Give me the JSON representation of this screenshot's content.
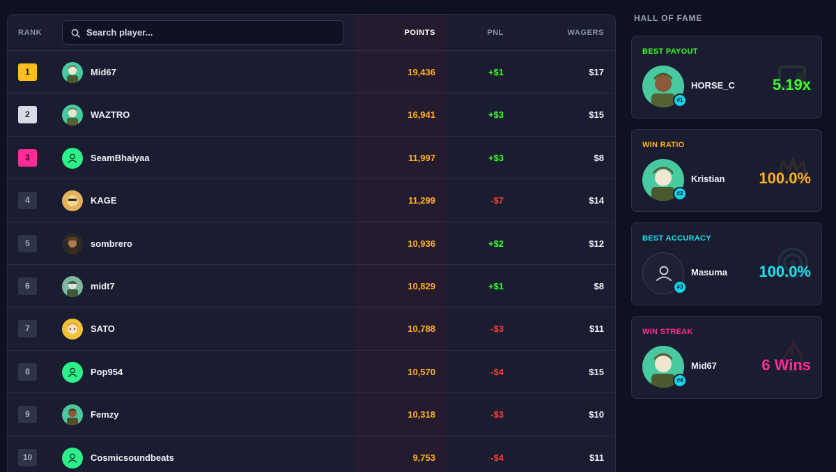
{
  "table": {
    "headers": {
      "rank": "RANK",
      "points": "POINTS",
      "pnl": "PNL",
      "wagers": "WAGERS"
    },
    "search": {
      "placeholder": "Search player..."
    },
    "rows": [
      {
        "rank": "1",
        "name": "Mid67",
        "points": "19,436",
        "pnl": "+$1",
        "wagers": "$17"
      },
      {
        "rank": "2",
        "name": "WAZTRO",
        "points": "16,941",
        "pnl": "+$3",
        "wagers": "$15"
      },
      {
        "rank": "3",
        "name": "SeamBhaiyaa",
        "points": "11,997",
        "pnl": "+$3",
        "wagers": "$8"
      },
      {
        "rank": "4",
        "name": "KAGE",
        "points": "11,299",
        "pnl": "-$7",
        "wagers": "$14"
      },
      {
        "rank": "5",
        "name": "sombrero",
        "points": "10,936",
        "pnl": "+$2",
        "wagers": "$12"
      },
      {
        "rank": "6",
        "name": "midt7",
        "points": "10,829",
        "pnl": "+$1",
        "wagers": "$8"
      },
      {
        "rank": "7",
        "name": "SATO",
        "points": "10,788",
        "pnl": "-$3",
        "wagers": "$11"
      },
      {
        "rank": "8",
        "name": "Pop954",
        "points": "10,570",
        "pnl": "-$4",
        "wagers": "$15"
      },
      {
        "rank": "9",
        "name": "Femzy",
        "points": "10,318",
        "pnl": "-$3",
        "wagers": "$10"
      },
      {
        "rank": "10",
        "name": "Cosmicsoundbeats",
        "points": "9,753",
        "pnl": "-$4",
        "wagers": "$11"
      }
    ]
  },
  "hall_of_fame": {
    "title": "HALL OF FAME",
    "cards": [
      {
        "label": "BEST PAYOUT",
        "name": "HORSE_C",
        "value": "5.19x",
        "badge": "#1",
        "color": "#3cff2c",
        "icon": "wallet-icon"
      },
      {
        "label": "WIN RATIO",
        "name": "Kristian",
        "value": "100.0%",
        "badge": "#2",
        "color": "#ffb020",
        "icon": "crown-icon"
      },
      {
        "label": "BEST ACCURACY",
        "name": "Masuma",
        "value": "100.0%",
        "badge": "#3",
        "color": "#19e4f2",
        "icon": "target-icon"
      },
      {
        "label": "WIN STREAK",
        "name": "Mid67",
        "value": "6 Wins",
        "badge": "#4",
        "color": "#ff2d95",
        "icon": "flame-icon"
      }
    ]
  },
  "colors": {
    "background": "#0e1120",
    "panel": "#1a1d2f",
    "points": "#ffb020",
    "pnl_positive": "#3cff2c",
    "pnl_negative": "#ff3a3a",
    "rank_gold": "#ffbf1a",
    "rank_silver": "#d7dbe6",
    "rank_bronze": "#ff2d95",
    "badge": "#12d4e8"
  }
}
